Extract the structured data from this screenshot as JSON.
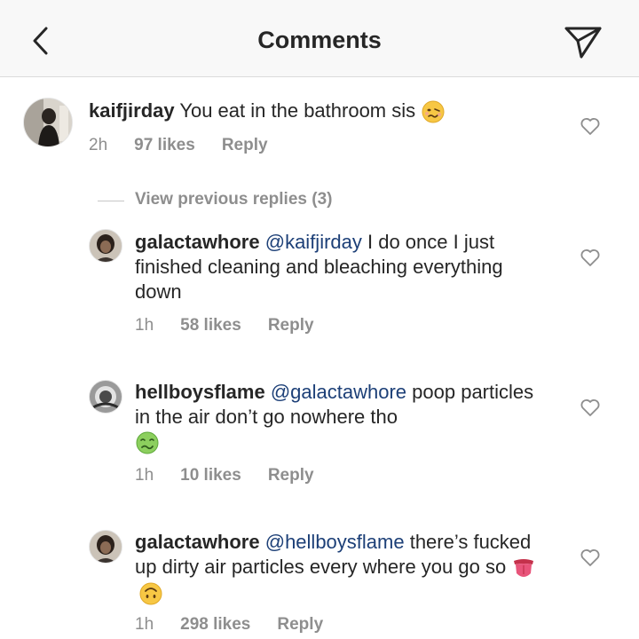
{
  "header": {
    "title": "Comments",
    "back_icon": "chevron-left-icon",
    "send_icon": "paper-plane-icon"
  },
  "thread": {
    "main": {
      "username": "kaifjirday",
      "text": " You eat in the bathroom sis ",
      "emoji": "woozy-face",
      "time": "2h",
      "likes": "97 likes",
      "reply": "Reply"
    },
    "view_previous": "View previous replies (3)",
    "replies": [
      {
        "username": "galactawhore",
        "mention": "@kaifjirday",
        "text": " I do once I just finished cleaning and bleaching everything down",
        "time": "1h",
        "likes": "58 likes",
        "reply": "Reply"
      },
      {
        "username": "hellboysflame",
        "mention": "@galactawhore",
        "text": " poop particles in the air don’t go nowhere tho",
        "emoji": "nauseated-face",
        "time": "1h",
        "likes": "10 likes",
        "reply": "Reply"
      },
      {
        "username": "galactawhore",
        "mention": "@hellboysflame",
        "text": " there’s fucked up dirty air particles every where you go so ",
        "emoji": [
          "tongue-emoji",
          "upside-down-face"
        ],
        "time": "1h",
        "likes": "298 likes",
        "reply": "Reply"
      }
    ]
  },
  "colors": {
    "mention": "#1c3f77",
    "meta": "#8e8e8e",
    "text": "#262626",
    "header_bg": "#f8f8f8"
  }
}
